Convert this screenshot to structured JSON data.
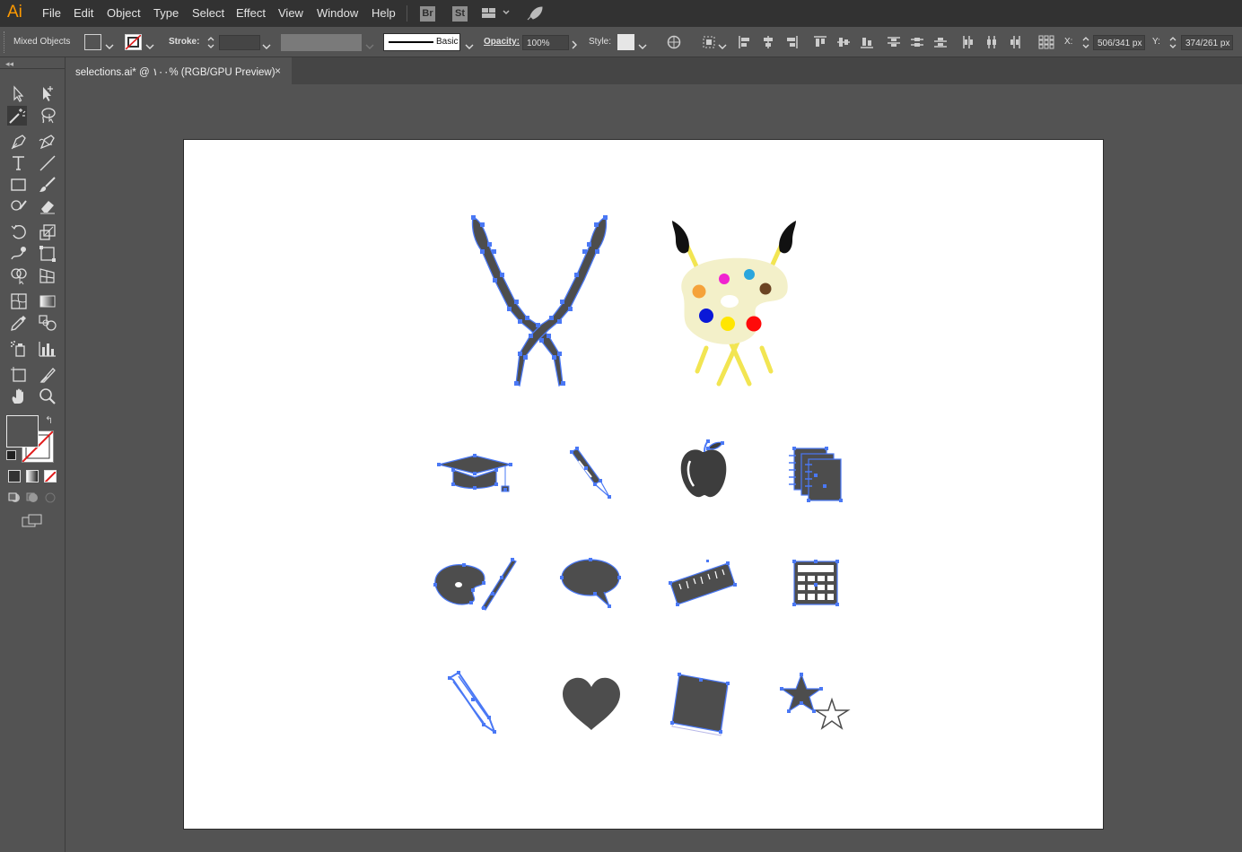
{
  "app": {
    "logo": "Ai"
  },
  "menu": [
    "File",
    "Edit",
    "Object",
    "Type",
    "Select",
    "Effect",
    "View",
    "Window",
    "Help"
  ],
  "bridge": {
    "br": "Br",
    "st": "St"
  },
  "control": {
    "selection_type": "Mixed Objects",
    "stroke_label": "Stroke:",
    "brush_label": "Basic",
    "opacity_label": "Opacity:",
    "opacity_value": "100%",
    "style_label": "Style:",
    "x_label": "X:",
    "x_value": "506/341 px",
    "y_label": "Y:",
    "y_value": "374/261 px"
  },
  "document": {
    "tab_title": "selections.ai* @ ۱۰۰% (RGB/GPU Preview)",
    "close": "×"
  },
  "colors": {
    "selection": "#4a78f5",
    "art_fill": "#4d4d4d",
    "panel": "#535353",
    "menubar": "#323232"
  },
  "tools": [
    "selection-icon",
    "direct-selection-icon",
    "magic-wand-icon",
    "lasso-icon",
    "pen-icon",
    "curvature-icon",
    "type-icon",
    "line-icon",
    "rectangle-icon",
    "paintbrush-icon",
    "shaper-icon",
    "eraser-icon",
    "rotate-icon",
    "scale-icon",
    "warp-icon",
    "free-transform-icon",
    "shape-builder-icon",
    "perspective-icon",
    "mesh-icon",
    "gradient-icon",
    "eyedropper-icon",
    "blend-icon",
    "symbol-sprayer-icon",
    "column-graph-icon",
    "artboard-icon",
    "slice-icon",
    "hand-icon",
    "zoom-icon"
  ]
}
